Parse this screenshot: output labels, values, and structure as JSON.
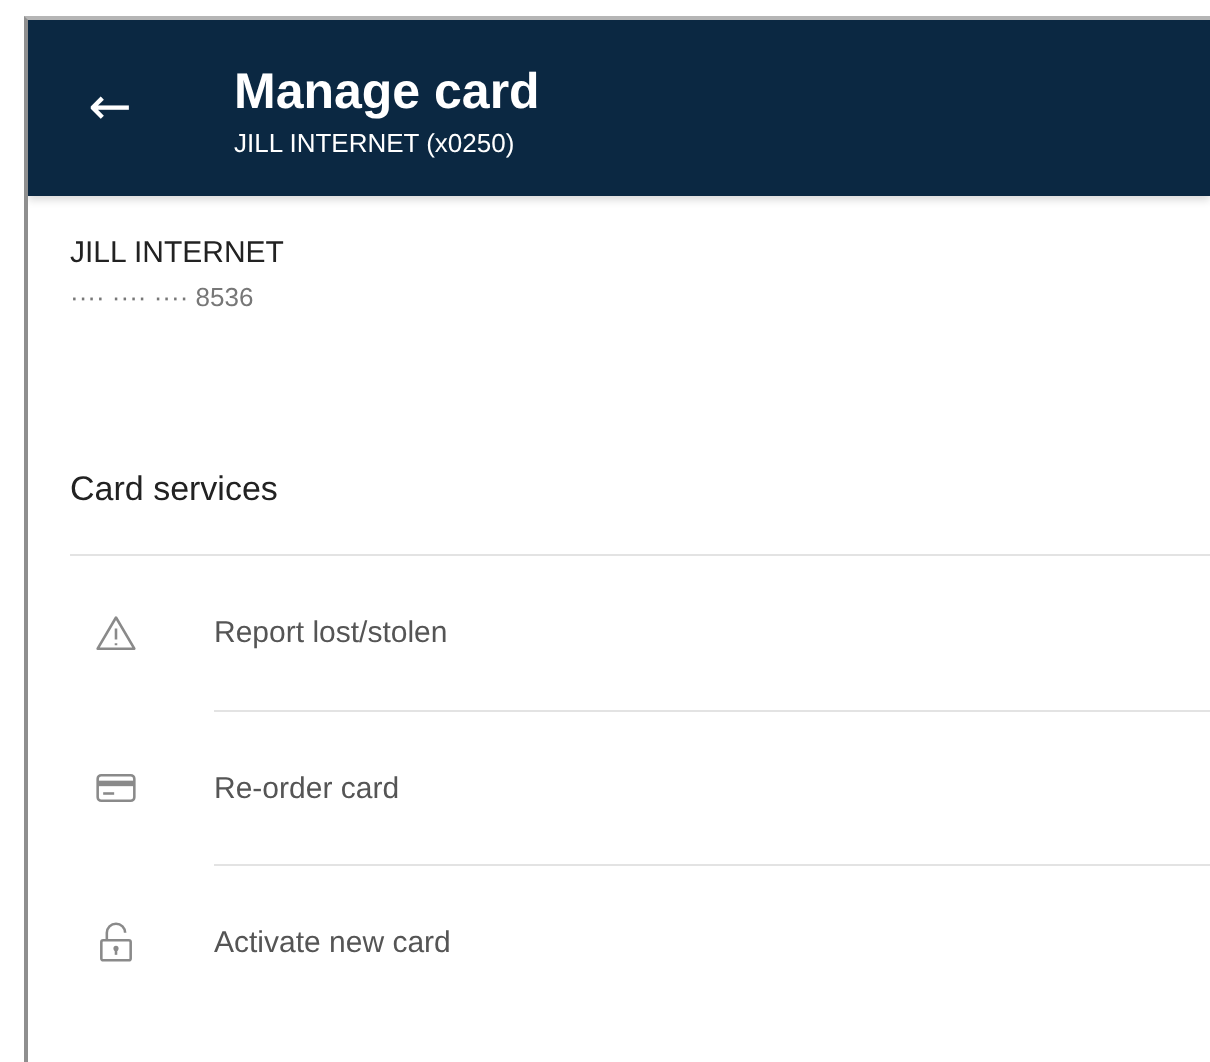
{
  "header": {
    "back_icon": "←",
    "title": "Manage card",
    "subtitle": "JILL INTERNET (x0250)"
  },
  "card": {
    "holder": "JILL INTERNET",
    "number": "···· ···· ···· 8536"
  },
  "section": {
    "title": "Card services",
    "items": [
      {
        "kind": "warning",
        "label": "Report lost/stolen"
      },
      {
        "kind": "card",
        "label": "Re-order card"
      },
      {
        "kind": "lock",
        "label": "Activate new card"
      }
    ]
  }
}
